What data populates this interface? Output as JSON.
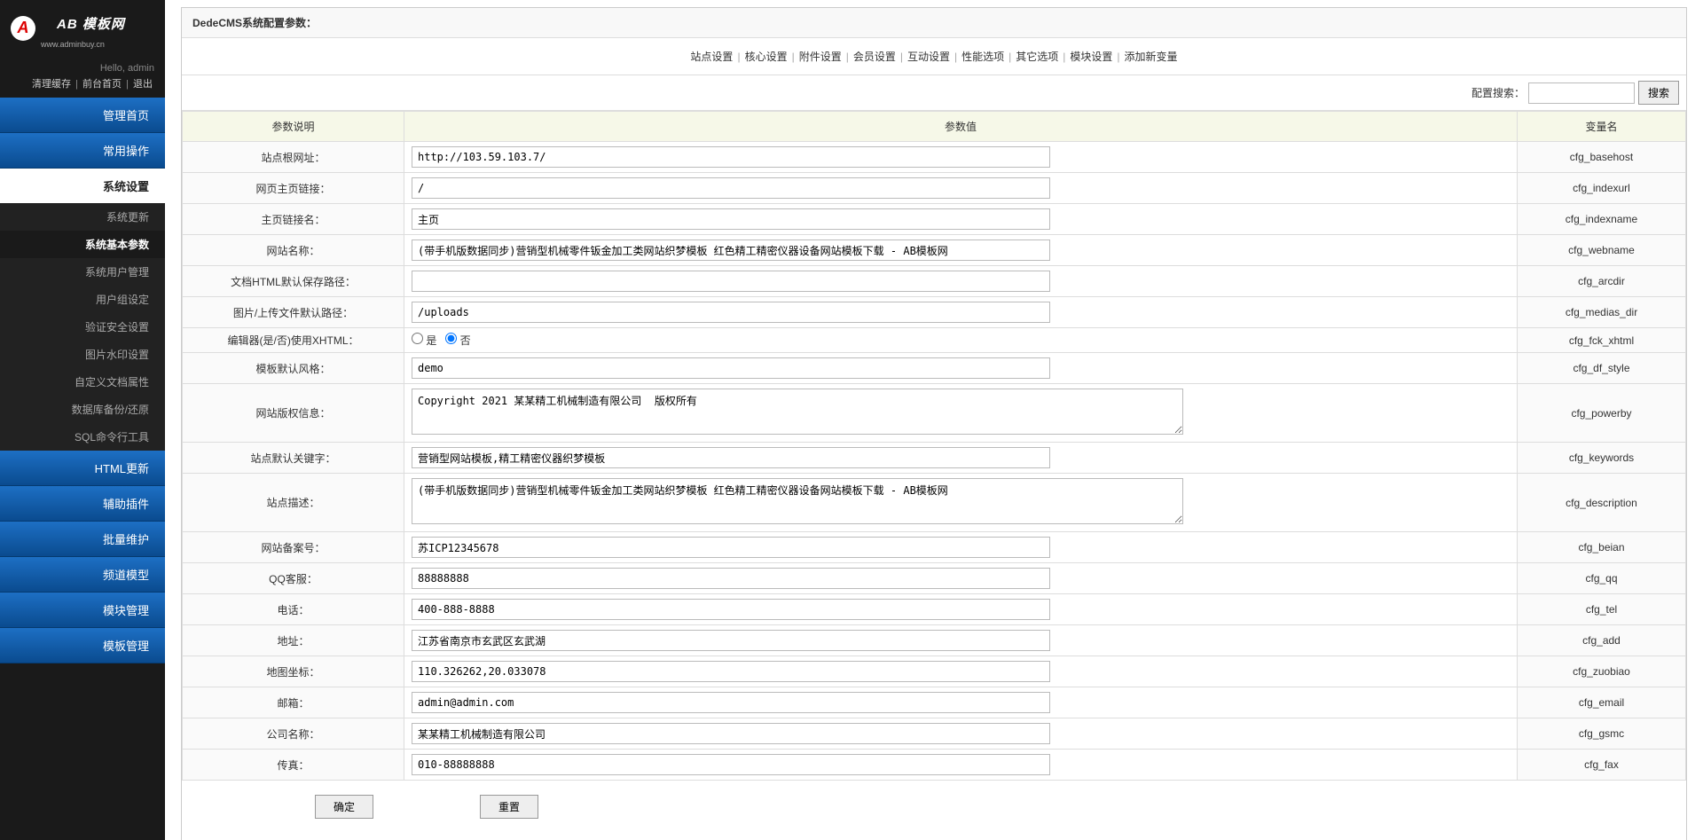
{
  "logo": {
    "main": "AB 模板网",
    "sub": "www.adminbuy.cn",
    "badge": "A"
  },
  "user": {
    "greeting": "Hello, admin",
    "links": [
      "清理缓存",
      "前台首页",
      "退出"
    ]
  },
  "nav": {
    "items": [
      {
        "label": "管理首页",
        "type": "top"
      },
      {
        "label": "常用操作",
        "type": "top"
      },
      {
        "label": "系统设置",
        "type": "active"
      },
      {
        "label": "系统更新",
        "type": "sub"
      },
      {
        "label": "系统基本参数",
        "type": "sub-active"
      },
      {
        "label": "系统用户管理",
        "type": "sub"
      },
      {
        "label": "用户组设定",
        "type": "sub"
      },
      {
        "label": "验证安全设置",
        "type": "sub"
      },
      {
        "label": "图片水印设置",
        "type": "sub"
      },
      {
        "label": "自定义文档属性",
        "type": "sub"
      },
      {
        "label": "数据库备份/还原",
        "type": "sub"
      },
      {
        "label": "SQL命令行工具",
        "type": "sub"
      },
      {
        "label": "HTML更新",
        "type": "top"
      },
      {
        "label": "辅助插件",
        "type": "top"
      },
      {
        "label": "批量维护",
        "type": "top"
      },
      {
        "label": "频道模型",
        "type": "top"
      },
      {
        "label": "模块管理",
        "type": "top"
      },
      {
        "label": "模板管理",
        "type": "top"
      }
    ]
  },
  "panel": {
    "title": "DedeCMS系统配置参数：",
    "tabs": [
      "站点设置",
      "核心设置",
      "附件设置",
      "会员设置",
      "互动设置",
      "性能选项",
      "其它选项",
      "模块设置",
      "添加新变量"
    ],
    "search_label": "配置搜索：",
    "search_button": "搜索",
    "th": {
      "desc": "参数说明",
      "val": "参数值",
      "var": "变量名"
    },
    "radio_yes": "是",
    "radio_no": "否",
    "rows": [
      {
        "desc": "站点根网址：",
        "var": "cfg_basehost",
        "type": "text",
        "value": "http://103.59.103.7/"
      },
      {
        "desc": "网页主页链接：",
        "var": "cfg_indexurl",
        "type": "text",
        "value": "/"
      },
      {
        "desc": "主页链接名：",
        "var": "cfg_indexname",
        "type": "text",
        "value": "主页"
      },
      {
        "desc": "网站名称：",
        "var": "cfg_webname",
        "type": "text",
        "value": "(带手机版数据同步)营销型机械零件钣金加工类网站织梦模板 红色精工精密仪器设备网站模板下载 - AB模板网"
      },
      {
        "desc": "文档HTML默认保存路径：",
        "var": "cfg_arcdir",
        "type": "text",
        "value": ""
      },
      {
        "desc": "图片/上传文件默认路径：",
        "var": "cfg_medias_dir",
        "type": "text",
        "value": "/uploads"
      },
      {
        "desc": "编辑器(是/否)使用XHTML：",
        "var": "cfg_fck_xhtml",
        "type": "radio",
        "value": "no"
      },
      {
        "desc": "模板默认风格：",
        "var": "cfg_df_style",
        "type": "text",
        "value": "demo"
      },
      {
        "desc": "网站版权信息：",
        "var": "cfg_powerby",
        "type": "textarea",
        "value": "Copyright 2021 某某精工机械制造有限公司  版权所有"
      },
      {
        "desc": "站点默认关键字：",
        "var": "cfg_keywords",
        "type": "text",
        "value": "营销型网站模板,精工精密仪器织梦模板"
      },
      {
        "desc": "站点描述：",
        "var": "cfg_description",
        "type": "textarea",
        "value": "(带手机版数据同步)营销型机械零件钣金加工类网站织梦模板 红色精工精密仪器设备网站模板下载 - AB模板网"
      },
      {
        "desc": "网站备案号：",
        "var": "cfg_beian",
        "type": "text",
        "value": "苏ICP12345678"
      },
      {
        "desc": "QQ客服：",
        "var": "cfg_qq",
        "type": "text",
        "value": "88888888"
      },
      {
        "desc": "电话：",
        "var": "cfg_tel",
        "type": "text",
        "value": "400-888-8888"
      },
      {
        "desc": "地址：",
        "var": "cfg_add",
        "type": "text",
        "value": "江苏省南京市玄武区玄武湖"
      },
      {
        "desc": "地图坐标：",
        "var": "cfg_zuobiao",
        "type": "text",
        "value": "110.326262,20.033078"
      },
      {
        "desc": "邮箱：",
        "var": "cfg_email",
        "type": "text",
        "value": "admin@admin.com"
      },
      {
        "desc": "公司名称：",
        "var": "cfg_gsmc",
        "type": "text",
        "value": "某某精工机械制造有限公司"
      },
      {
        "desc": "传真：",
        "var": "cfg_fax",
        "type": "text",
        "value": "010-88888888"
      }
    ],
    "actions": {
      "ok": "确定",
      "reset": "重置"
    }
  }
}
